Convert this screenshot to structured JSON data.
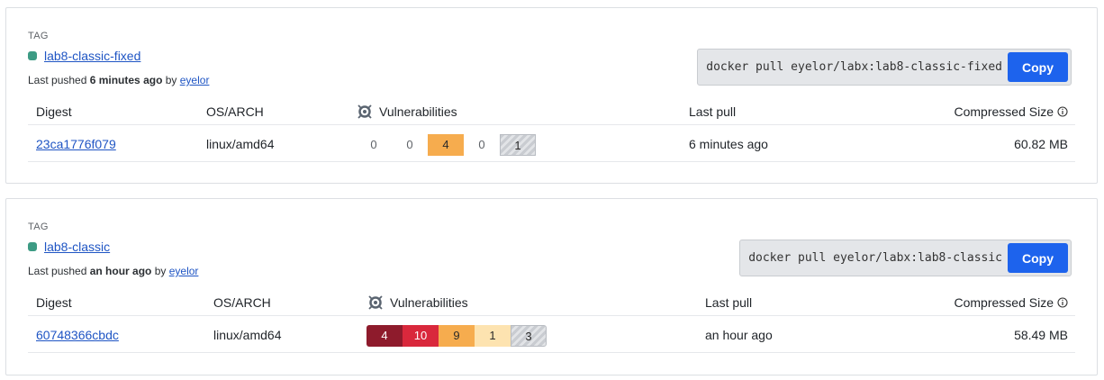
{
  "tags": [
    {
      "tag_label": "TAG",
      "name": "lab8-classic-fixed",
      "pushed_prefix": "Last pushed ",
      "pushed_time": "6 minutes ago",
      "pushed_by": " by ",
      "user": "eyelor",
      "pull_command": "docker pull eyelor/labx:lab8-classic-fixed",
      "copy_label": "Copy",
      "headers": {
        "digest": "Digest",
        "os_arch": "OS/ARCH",
        "vulnerabilities": "Vulnerabilities",
        "last_pull": "Last pull",
        "compressed_size": "Compressed Size"
      },
      "row": {
        "digest": "23ca1776f079",
        "os_arch": "linux/amd64",
        "last_pull": "6 minutes ago",
        "size": "60.82 MB"
      },
      "vulns": {
        "critical": "0",
        "high": "0",
        "medium": "4",
        "low": "0",
        "unspecified": "1"
      }
    },
    {
      "tag_label": "TAG",
      "name": "lab8-classic",
      "pushed_prefix": "Last pushed ",
      "pushed_time": "an hour ago",
      "pushed_by": " by ",
      "user": "eyelor",
      "pull_command": "docker pull eyelor/labx:lab8-classic",
      "copy_label": "Copy",
      "headers": {
        "digest": "Digest",
        "os_arch": "OS/ARCH",
        "vulnerabilities": "Vulnerabilities",
        "last_pull": "Last pull",
        "compressed_size": "Compressed Size"
      },
      "row": {
        "digest": "60748366cbdc",
        "os_arch": "linux/amd64",
        "last_pull": "an hour ago",
        "size": "58.49 MB"
      },
      "vulns": {
        "critical": "4",
        "high": "10",
        "medium": "9",
        "low": "1",
        "unspecified": "3"
      }
    }
  ],
  "colors": {
    "critical": "#8e1b2c",
    "high": "#d9283c",
    "medium": "#f6ac4e",
    "low": "#fde3b0",
    "accent": "#1d63ed",
    "tag_dot": "#3d9b84"
  },
  "icons": {
    "vulnerabilities": "scan-shield-icon",
    "info": "info-circle-icon"
  }
}
